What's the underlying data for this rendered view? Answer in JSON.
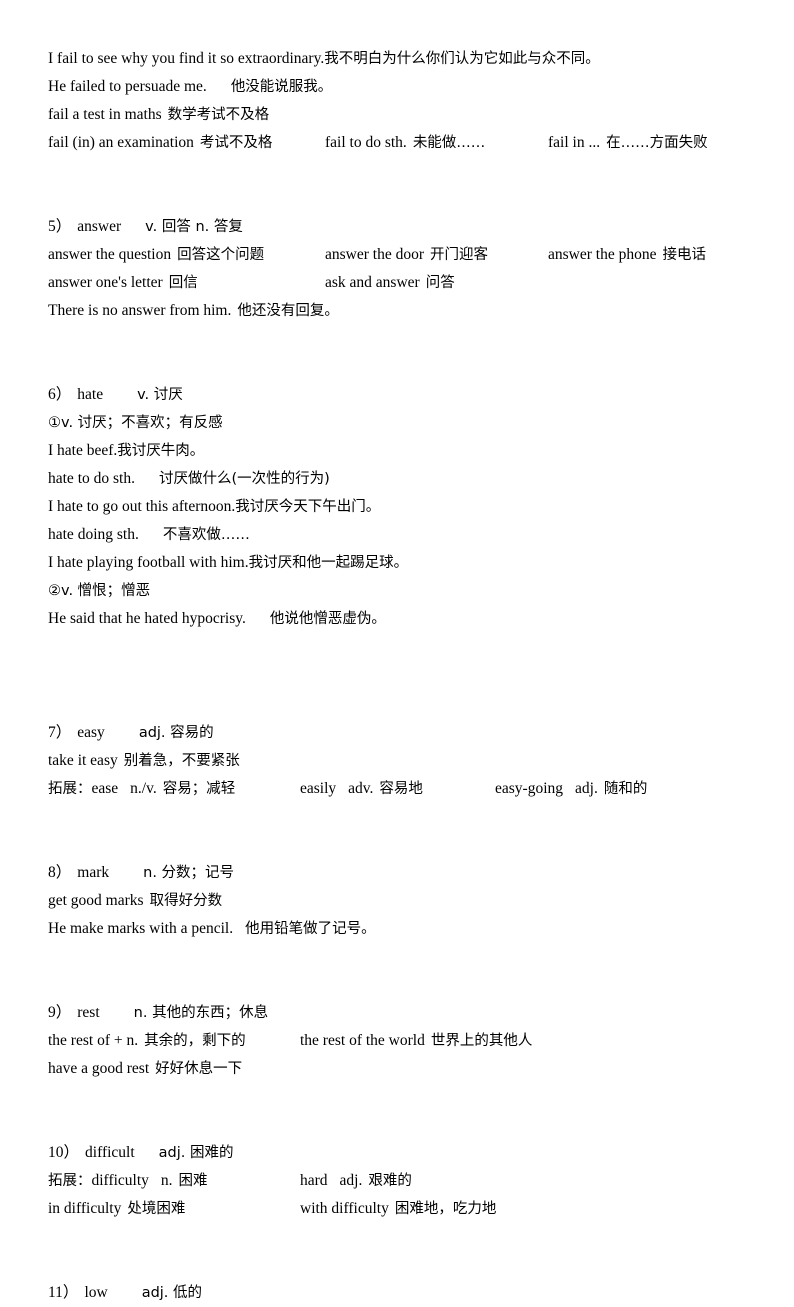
{
  "document": {
    "type": "vocabulary-study-notes",
    "language": "English-Chinese",
    "background_color": "#ffffff",
    "text_color": "#000000"
  },
  "entries": [
    {
      "id": "fail",
      "lines": [
        {
          "id": "fail-example-1",
          "cols": [
            {
              "en": "I fail to see why you find it so extraordinary.",
              "cn": "我不明白为什么你们认为它如此与众不同。"
            }
          ]
        },
        {
          "id": "fail-example-2",
          "cols": [
            {
              "en": "He failed to persuade me.",
              "cn": "他没能说服我。"
            }
          ]
        },
        {
          "id": "fail-phrase-1",
          "cols": [
            {
              "en": "fail a test in maths",
              "cn": "数学考试不及格"
            }
          ]
        },
        {
          "id": "fail-phrase-row",
          "cols": [
            {
              "en": "fail (in) an examination",
              "cn": "考试不及格"
            },
            {
              "en": "fail to do sth.",
              "cn": "未能做……"
            },
            {
              "en": "fail in ...",
              "cn": "在……方面失败"
            }
          ]
        }
      ]
    },
    {
      "id": "answer",
      "number": "5）",
      "headword": "answer",
      "pos_list": "v. 回答  n. 答复",
      "lines": [
        {
          "id": "answer-phrase-row-1",
          "cols": [
            {
              "en": "answer the question",
              "cn": "回答这个问题"
            },
            {
              "en": "answer the door",
              "cn": "开门迎客"
            },
            {
              "en": "answer the phone",
              "cn": "接电话"
            }
          ]
        },
        {
          "id": "answer-phrase-row-2",
          "cols": [
            {
              "en": "answer one's letter",
              "cn": "回信"
            },
            {
              "en": "ask and answer",
              "cn": "问答"
            }
          ]
        },
        {
          "id": "answer-example-1",
          "cols": [
            {
              "en": "There is no answer from him.",
              "cn": "他还没有回复。"
            }
          ]
        }
      ]
    },
    {
      "id": "hate",
      "number": "6）",
      "headword": "hate",
      "pos_list": "v. 讨厌",
      "lines": [
        {
          "id": "hate-sense-1",
          "cols": [
            {
              "en": "①v. 讨厌；不喜欢；有反感",
              "cn": ""
            }
          ]
        },
        {
          "id": "hate-example-1",
          "cols": [
            {
              "en": "I hate beef.",
              "cn": "我讨厌牛肉。"
            }
          ]
        },
        {
          "id": "hate-pattern-1",
          "cols": [
            {
              "en": "hate to do sth.",
              "cn": "讨厌做什么(一次性的行为)"
            }
          ]
        },
        {
          "id": "hate-example-2",
          "cols": [
            {
              "en": "I hate to go out this afternoon.",
              "cn": "我讨厌今天下午出门。"
            }
          ]
        },
        {
          "id": "hate-pattern-2",
          "cols": [
            {
              "en": "hate doing sth.",
              "cn": "不喜欢做……"
            }
          ]
        },
        {
          "id": "hate-example-3",
          "cols": [
            {
              "en": "I hate playing football with him.",
              "cn": "我讨厌和他一起踢足球。"
            }
          ]
        },
        {
          "id": "hate-sense-2",
          "cols": [
            {
              "en": "②v. 憎恨；憎恶",
              "cn": ""
            }
          ]
        },
        {
          "id": "hate-example-4",
          "cols": [
            {
              "en": "He said that he hated hypocrisy.",
              "cn": "他说他憎恶虚伪。"
            }
          ]
        }
      ]
    },
    {
      "id": "easy",
      "number": "7）",
      "headword": "easy",
      "pos_list": "adj. 容易的",
      "lines": [
        {
          "id": "easy-phrase-1",
          "cols": [
            {
              "en": "take it easy",
              "cn": "别着急，不要紧张"
            }
          ]
        },
        {
          "id": "easy-extension-row",
          "prefix": "拓展：",
          "cols": [
            {
              "en": "ease",
              "pos": "n./v.",
              "cn": "容易；减轻"
            },
            {
              "en": "easily",
              "pos": "adv.",
              "cn": "容易地"
            },
            {
              "en": "easy-going",
              "pos": "adj.",
              "cn": "随和的"
            }
          ]
        }
      ]
    },
    {
      "id": "mark",
      "number": "8）",
      "headword": "mark",
      "pos_list": "n. 分数；记号",
      "lines": [
        {
          "id": "mark-phrase-1",
          "cols": [
            {
              "en": "get good marks",
              "cn": "取得好分数"
            }
          ]
        },
        {
          "id": "mark-example-1",
          "cols": [
            {
              "en": "He make marks with a pencil.",
              "cn": "他用铅笔做了记号。"
            }
          ]
        }
      ]
    },
    {
      "id": "rest",
      "number": "9）",
      "headword": "rest",
      "pos_list": "n. 其他的东西；休息",
      "lines": [
        {
          "id": "rest-phrase-row",
          "cols": [
            {
              "en": "the rest of + n.",
              "cn": "其余的，剩下的"
            },
            {
              "en": "the rest of the world",
              "cn": "世界上的其他人"
            }
          ]
        },
        {
          "id": "rest-phrase-2",
          "cols": [
            {
              "en": "have a good rest",
              "cn": "好好休息一下"
            }
          ]
        }
      ]
    },
    {
      "id": "difficult",
      "number": "10）",
      "headword": "difficult",
      "pos_list": "adj. 困难的",
      "lines": [
        {
          "id": "difficult-extension-row",
          "prefix": "拓展：",
          "cols": [
            {
              "en": "difficulty",
              "pos": "n.",
              "cn": "困难"
            },
            {
              "en": "hard",
              "pos": "adj.",
              "cn": "艰难的"
            }
          ]
        },
        {
          "id": "difficult-phrase-row",
          "cols": [
            {
              "en": "in difficulty",
              "cn": "处境困难"
            },
            {
              "en": "with difficulty",
              "cn": "困难地，吃力地"
            }
          ]
        }
      ]
    },
    {
      "id": "low",
      "number": "11）",
      "headword": "low",
      "pos_list": "adj. 低的",
      "lines": []
    }
  ]
}
